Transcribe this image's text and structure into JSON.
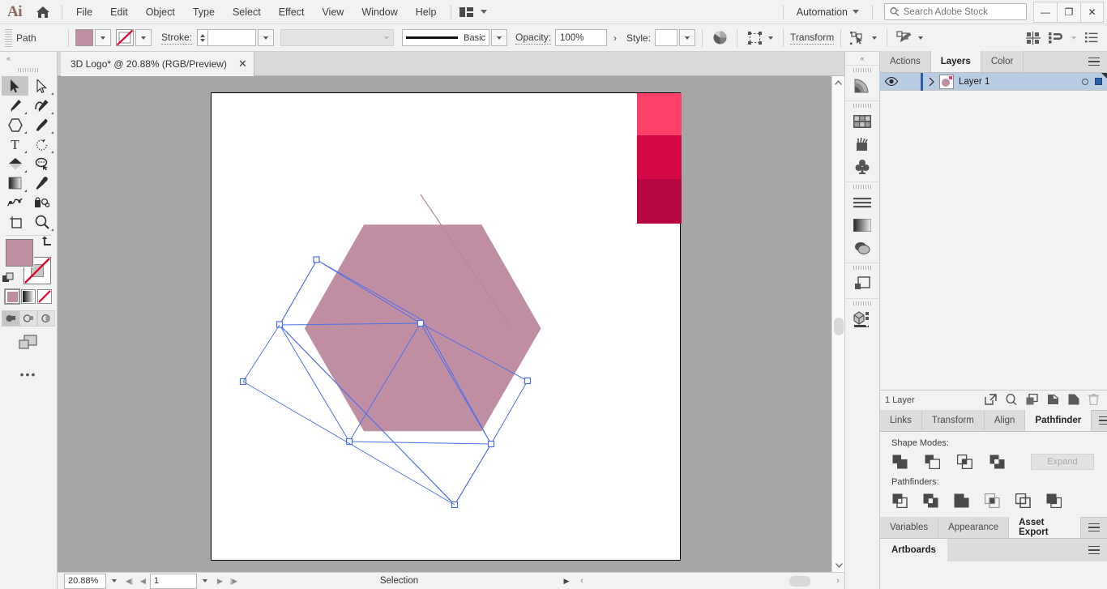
{
  "app": {
    "name": "Ai",
    "logo_icon": "illustrator-logo-icon",
    "home_icon": "home-icon"
  },
  "menubar": {
    "items": [
      "File",
      "Edit",
      "Object",
      "Type",
      "Select",
      "Effect",
      "View",
      "Window",
      "Help"
    ],
    "arrange_icon": "arrange-documents-icon",
    "workspace": "Automation",
    "search": {
      "placeholder": "Search Adobe Stock",
      "value": "",
      "icon": "search-icon"
    },
    "window_buttons": {
      "minimize": "—",
      "restore": "❐",
      "close": "✕"
    }
  },
  "controlbar": {
    "object_label": "Path",
    "fill_color": "#c08ea3",
    "stroke_swatch": "none-swatch",
    "stroke_label": "Stroke:",
    "stroke_weight": "",
    "stroke_profile_placeholder": "",
    "brush_definition": "Basic",
    "opacity_label": "Opacity:",
    "opacity_value": "100%",
    "style_label": "Style:",
    "style_value": "",
    "transform_label": "Transform",
    "icons": [
      "align-icon",
      "select-similar-icon",
      "isolate-group-icon",
      "recolor-artwork-icon",
      "distribute-icon",
      "arrange-objects-icon",
      "document-setup-icon"
    ]
  },
  "toolbar": {
    "collapse_icon": "collapse-panel-icon",
    "tools": [
      {
        "name": "selection-tool",
        "icon": "arrow-solid-icon",
        "selected": true,
        "has_flyout": false
      },
      {
        "name": "direct-selection-tool",
        "icon": "arrow-outline-icon",
        "selected": false,
        "has_flyout": true
      },
      {
        "name": "pen-tool",
        "icon": "pen-icon",
        "selected": false,
        "has_flyout": true
      },
      {
        "name": "curvature-tool",
        "icon": "curvature-icon",
        "selected": false,
        "has_flyout": true
      },
      {
        "name": "shape-tool",
        "icon": "polygon-icon",
        "selected": false,
        "has_flyout": true
      },
      {
        "name": "paintbrush-tool",
        "icon": "paintbrush-icon",
        "selected": false,
        "has_flyout": true
      },
      {
        "name": "type-tool",
        "icon": "type-t-icon",
        "selected": false,
        "has_flyout": true
      },
      {
        "name": "rotate-tool",
        "icon": "rotate-icon",
        "selected": false,
        "has_flyout": true
      },
      {
        "name": "eraser-tool",
        "icon": "eraser-icon",
        "selected": false,
        "has_flyout": true
      },
      {
        "name": "lasso-tool",
        "icon": "lasso-cursor-icon",
        "selected": false,
        "has_flyout": false
      },
      {
        "name": "gradient-tool",
        "icon": "gradient-icon",
        "selected": false,
        "has_flyout": true
      },
      {
        "name": "eyedropper-tool",
        "icon": "eyedropper-icon",
        "selected": false,
        "has_flyout": false
      },
      {
        "name": "blend-tool",
        "icon": "blend-icon",
        "selected": false,
        "has_flyout": false
      },
      {
        "name": "symbol-sprayer-tool",
        "icon": "symbol-sprayer-icon",
        "selected": false,
        "has_flyout": false
      },
      {
        "name": "artboard-tool",
        "icon": "artboard-icon",
        "selected": false,
        "has_flyout": false
      },
      {
        "name": "zoom-tool",
        "icon": "magnifier-icon",
        "selected": false,
        "has_flyout": true
      }
    ],
    "fill_color": "#c08ea3",
    "stroke_color": "#ffffff",
    "swap_icon": "swap-fill-stroke-icon",
    "default_icon": "default-fill-stroke-icon",
    "color_modes": [
      {
        "name": "fill-color-mode",
        "icon": "solid-color-icon",
        "active": true
      },
      {
        "name": "gradient-mode",
        "icon": "gradient-swatch-icon",
        "active": false
      },
      {
        "name": "none-mode",
        "icon": "none-swatch-icon",
        "active": false
      }
    ],
    "draw_modes": [
      {
        "name": "draw-normal",
        "icon": "draw-normal-icon",
        "active": true
      },
      {
        "name": "draw-behind",
        "icon": "draw-behind-icon",
        "active": false
      },
      {
        "name": "draw-inside",
        "icon": "draw-inside-icon",
        "active": false
      }
    ],
    "screen_mode_icon": "change-screen-mode-icon",
    "more_tools": "•••"
  },
  "document": {
    "tab_title": "3D Logo* @ 20.88% (RGB/Preview)",
    "close_icon": "close-tab-icon"
  },
  "canvas": {
    "artboard_bg": "#ffffff",
    "canvas_bg": "#a6a6a6",
    "hexagon_fill": "#c08ea3",
    "hexagon_shade": "#b98a9d",
    "selection_color": "#4a6fe8",
    "swatches": [
      {
        "name": "swatch-pink",
        "color": "#fc4068"
      },
      {
        "name": "swatch-crimson",
        "color": "#d40844"
      },
      {
        "name": "swatch-dark-red",
        "color": "#b80740"
      }
    ]
  },
  "statusbar": {
    "zoom_level": "20.88%",
    "artboard_number": "1",
    "status_text": "Selection",
    "first_icon": "first-artboard-icon",
    "prev_icon": "previous-artboard-icon",
    "next_icon": "next-artboard-icon",
    "last_icon": "last-artboard-icon",
    "menu_icon": "status-menu-icon"
  },
  "icondock": {
    "collapse_icon": "collapse-dock-icon",
    "groups": [
      {
        "icons": [
          {
            "name": "gradient-panel-icon"
          }
        ]
      },
      {
        "icons": [
          {
            "name": "swatches-panel-icon"
          },
          {
            "name": "brushes-panel-icon"
          },
          {
            "name": "symbols-panel-icon"
          }
        ]
      },
      {
        "icons": [
          {
            "name": "stroke-panel-icon"
          },
          {
            "name": "gradient-tool-panel-icon"
          },
          {
            "name": "transparency-panel-icon"
          }
        ]
      },
      {
        "icons": [
          {
            "name": "layers-dock-icon"
          }
        ]
      },
      {
        "icons": [
          {
            "name": "3d-materials-panel-icon"
          }
        ]
      }
    ]
  },
  "panels": {
    "top_group": {
      "tabs": [
        {
          "label": "Actions",
          "active": false
        },
        {
          "label": "Layers",
          "active": true
        },
        {
          "label": "Color",
          "active": false
        }
      ],
      "menu_icon": "panel-menu-icon",
      "layers": [
        {
          "name": "Layer 1",
          "visible": true,
          "locked": false,
          "selected": true,
          "eye_icon": "eye-icon",
          "expand_icon": "chevron-right-icon",
          "target_icon": "target-circle-icon",
          "select_icon": "selected-art-square-icon"
        }
      ],
      "footer": {
        "count_label": "1 Layer",
        "icons": [
          {
            "name": "locate-object-icon"
          },
          {
            "name": "find-layer-icon"
          },
          {
            "name": "new-sublayer-icon"
          },
          {
            "name": "make-clipping-mask-icon"
          },
          {
            "name": "new-layer-icon"
          },
          {
            "name": "delete-layer-icon"
          }
        ]
      }
    },
    "mid_group": {
      "tabs": [
        {
          "label": "Links",
          "active": false
        },
        {
          "label": "Transform",
          "active": false
        },
        {
          "label": "Align",
          "active": false
        },
        {
          "label": "Pathfinder",
          "active": true
        }
      ],
      "menu_icon": "panel-menu-icon",
      "shape_modes_label": "Shape Modes:",
      "shape_modes": [
        {
          "name": "unite-button"
        },
        {
          "name": "minus-front-button"
        },
        {
          "name": "intersect-button"
        },
        {
          "name": "exclude-button"
        }
      ],
      "expand_label": "Expand",
      "pathfinders_label": "Pathfinders:",
      "pathfinders": [
        {
          "name": "divide-button"
        },
        {
          "name": "trim-button"
        },
        {
          "name": "merge-button"
        },
        {
          "name": "crop-button"
        },
        {
          "name": "outline-button"
        },
        {
          "name": "minus-back-button"
        }
      ]
    },
    "bottom_group": {
      "tabs": [
        {
          "label": "Variables",
          "active": false
        },
        {
          "label": "Appearance",
          "active": false
        },
        {
          "label": "Asset Export",
          "active": true
        }
      ],
      "menu_icon": "panel-menu-icon"
    },
    "artboards_group": {
      "tabs": [
        {
          "label": "Artboards",
          "active": true
        }
      ],
      "menu_icon": "panel-menu-icon"
    }
  }
}
